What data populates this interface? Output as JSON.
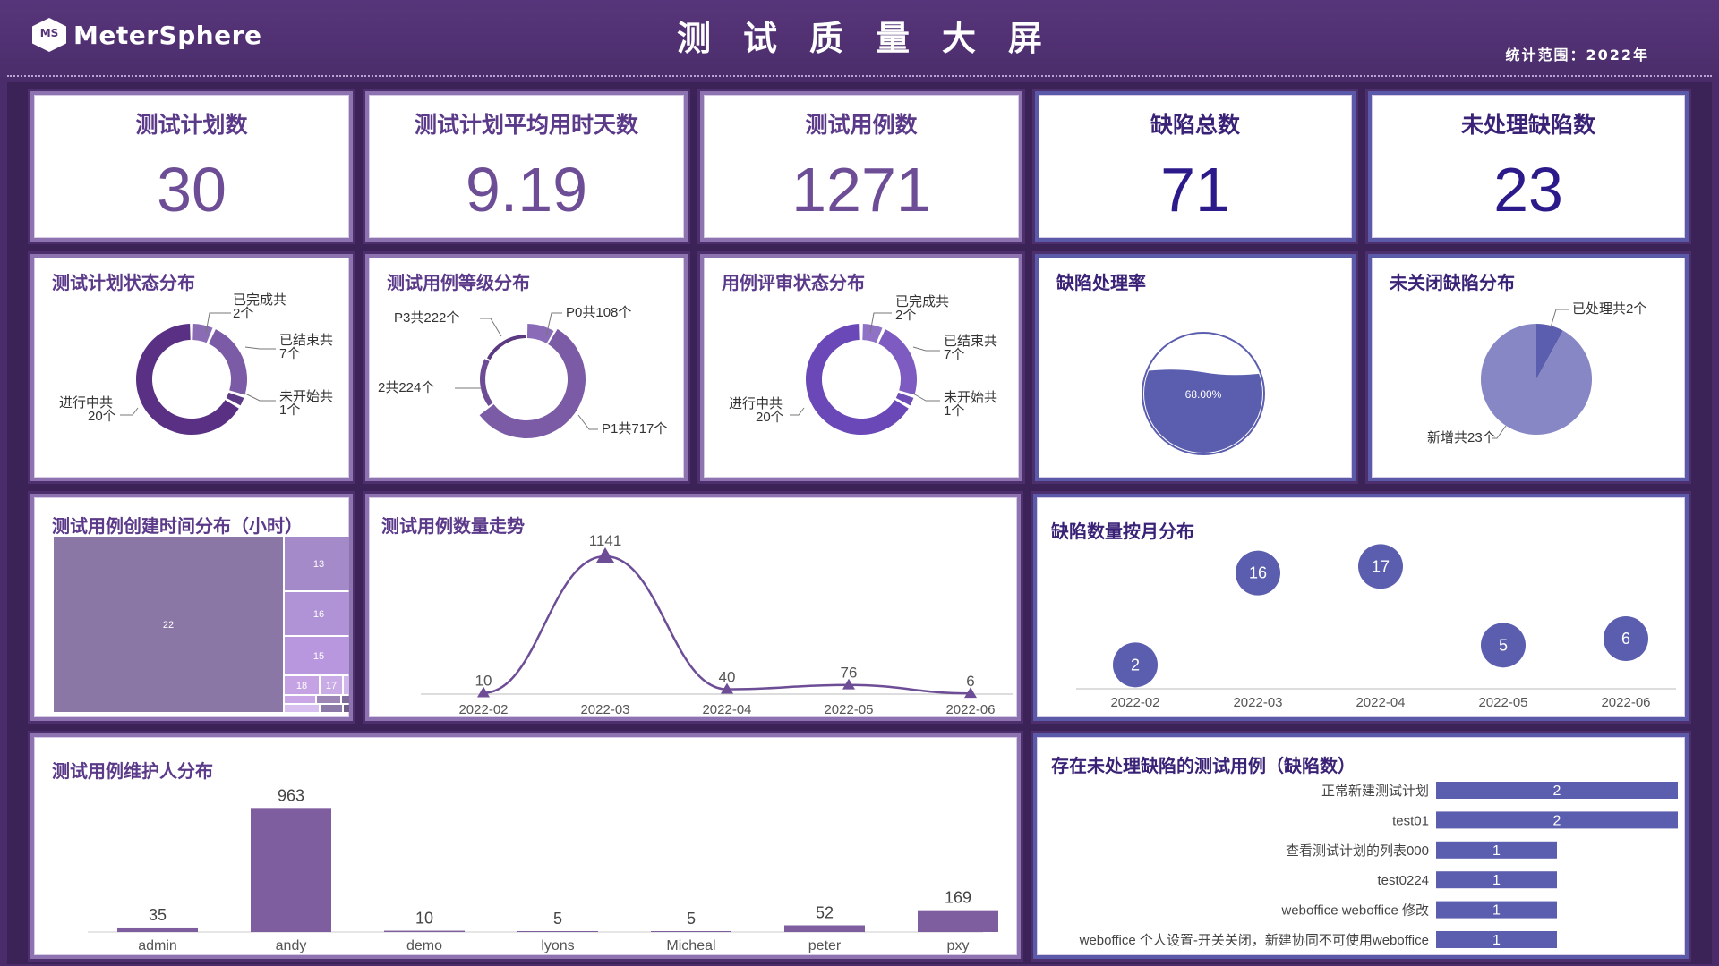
{
  "header": {
    "logo_mark": "MS",
    "logo_text": "MeterSphere",
    "title": "测试质量大屏",
    "range": "统计范围：2022年"
  },
  "stats": [
    {
      "label": "测试计划数",
      "value": "30"
    },
    {
      "label": "测试计划平均用时天数",
      "value": "9.19"
    },
    {
      "label": "测试用例数",
      "value": "1271"
    },
    {
      "label": "缺陷总数",
      "value": "71"
    },
    {
      "label": "未处理缺陷数",
      "value": "23"
    }
  ],
  "colors": {
    "purple_dark": "#5b3a8a",
    "purple": "#7a5a9e",
    "purple_light": "#8d74b0",
    "blue": "#5b5eae",
    "blue_light": "#8787c6"
  },
  "plan_status": {
    "title": "测试计划状态分布",
    "slices": [
      {
        "name": "已完成共",
        "count": "2个",
        "value": 2
      },
      {
        "name": "已结束共",
        "count": "7个",
        "value": 7
      },
      {
        "name": "未开始共",
        "count": "1个",
        "value": 1
      },
      {
        "name": "进行中共",
        "count": "20个",
        "value": 20
      }
    ]
  },
  "case_level": {
    "title": "测试用例等级分布",
    "slices": [
      {
        "label": "P0共108个",
        "value": 108
      },
      {
        "label": "P1共717个",
        "value": 717
      },
      {
        "label": "2共224个",
        "value": 224
      },
      {
        "label": "P3共222个",
        "value": 222
      }
    ]
  },
  "review_status": {
    "title": "用例评审状态分布",
    "slices": [
      {
        "name": "已完成共",
        "count": "2个",
        "value": 2
      },
      {
        "name": "已结束共",
        "count": "7个",
        "value": 7
      },
      {
        "name": "未开始共",
        "count": "1个",
        "value": 1
      },
      {
        "name": "进行中共",
        "count": "20个",
        "value": 20
      }
    ]
  },
  "defect_rate": {
    "title": "缺陷处理率",
    "value": 0.68,
    "label": "68.00%"
  },
  "open_defects": {
    "title": "未关闭缺陷分布",
    "slices": [
      {
        "label": "已处理共2个",
        "value": 2
      },
      {
        "label": "新增共23个",
        "value": 23
      }
    ]
  },
  "treemap": {
    "title": "测试用例创建时间分布（小时）",
    "cells": [
      "22",
      "13",
      "16",
      "15",
      "18",
      "17"
    ]
  },
  "trend": {
    "title": "测试用例数量走势",
    "chart_data": {
      "type": "line",
      "x": [
        "2022-02",
        "2022-03",
        "2022-04",
        "2022-05",
        "2022-06"
      ],
      "values": [
        10,
        1141,
        40,
        76,
        6
      ]
    }
  },
  "monthly_defects": {
    "title": "缺陷数量按月分布",
    "chart_data": {
      "type": "scatter",
      "x": [
        "2022-02",
        "2022-03",
        "2022-04",
        "2022-05",
        "2022-06"
      ],
      "values": [
        2,
        16,
        17,
        5,
        6
      ]
    }
  },
  "maintainers": {
    "title": "测试用例维护人分布",
    "chart_data": {
      "type": "bar",
      "categories": [
        "admin",
        "andy",
        "demo",
        "lyons",
        "Micheal",
        "peter",
        "pxy"
      ],
      "values": [
        35,
        963,
        10,
        5,
        5,
        52,
        169
      ]
    }
  },
  "defect_cases": {
    "title": "存在未处理缺陷的测试用例（缺陷数）",
    "chart_data": {
      "type": "bar",
      "categories": [
        "正常新建测试计划",
        "test01",
        "查看测试计划的列表000",
        "test0224",
        "weboffice weboffice 修改",
        "weboffice 个人设置-开关关闭，新建协同不可使用weboffice"
      ],
      "values": [
        2,
        2,
        1,
        1,
        1,
        1
      ]
    }
  }
}
